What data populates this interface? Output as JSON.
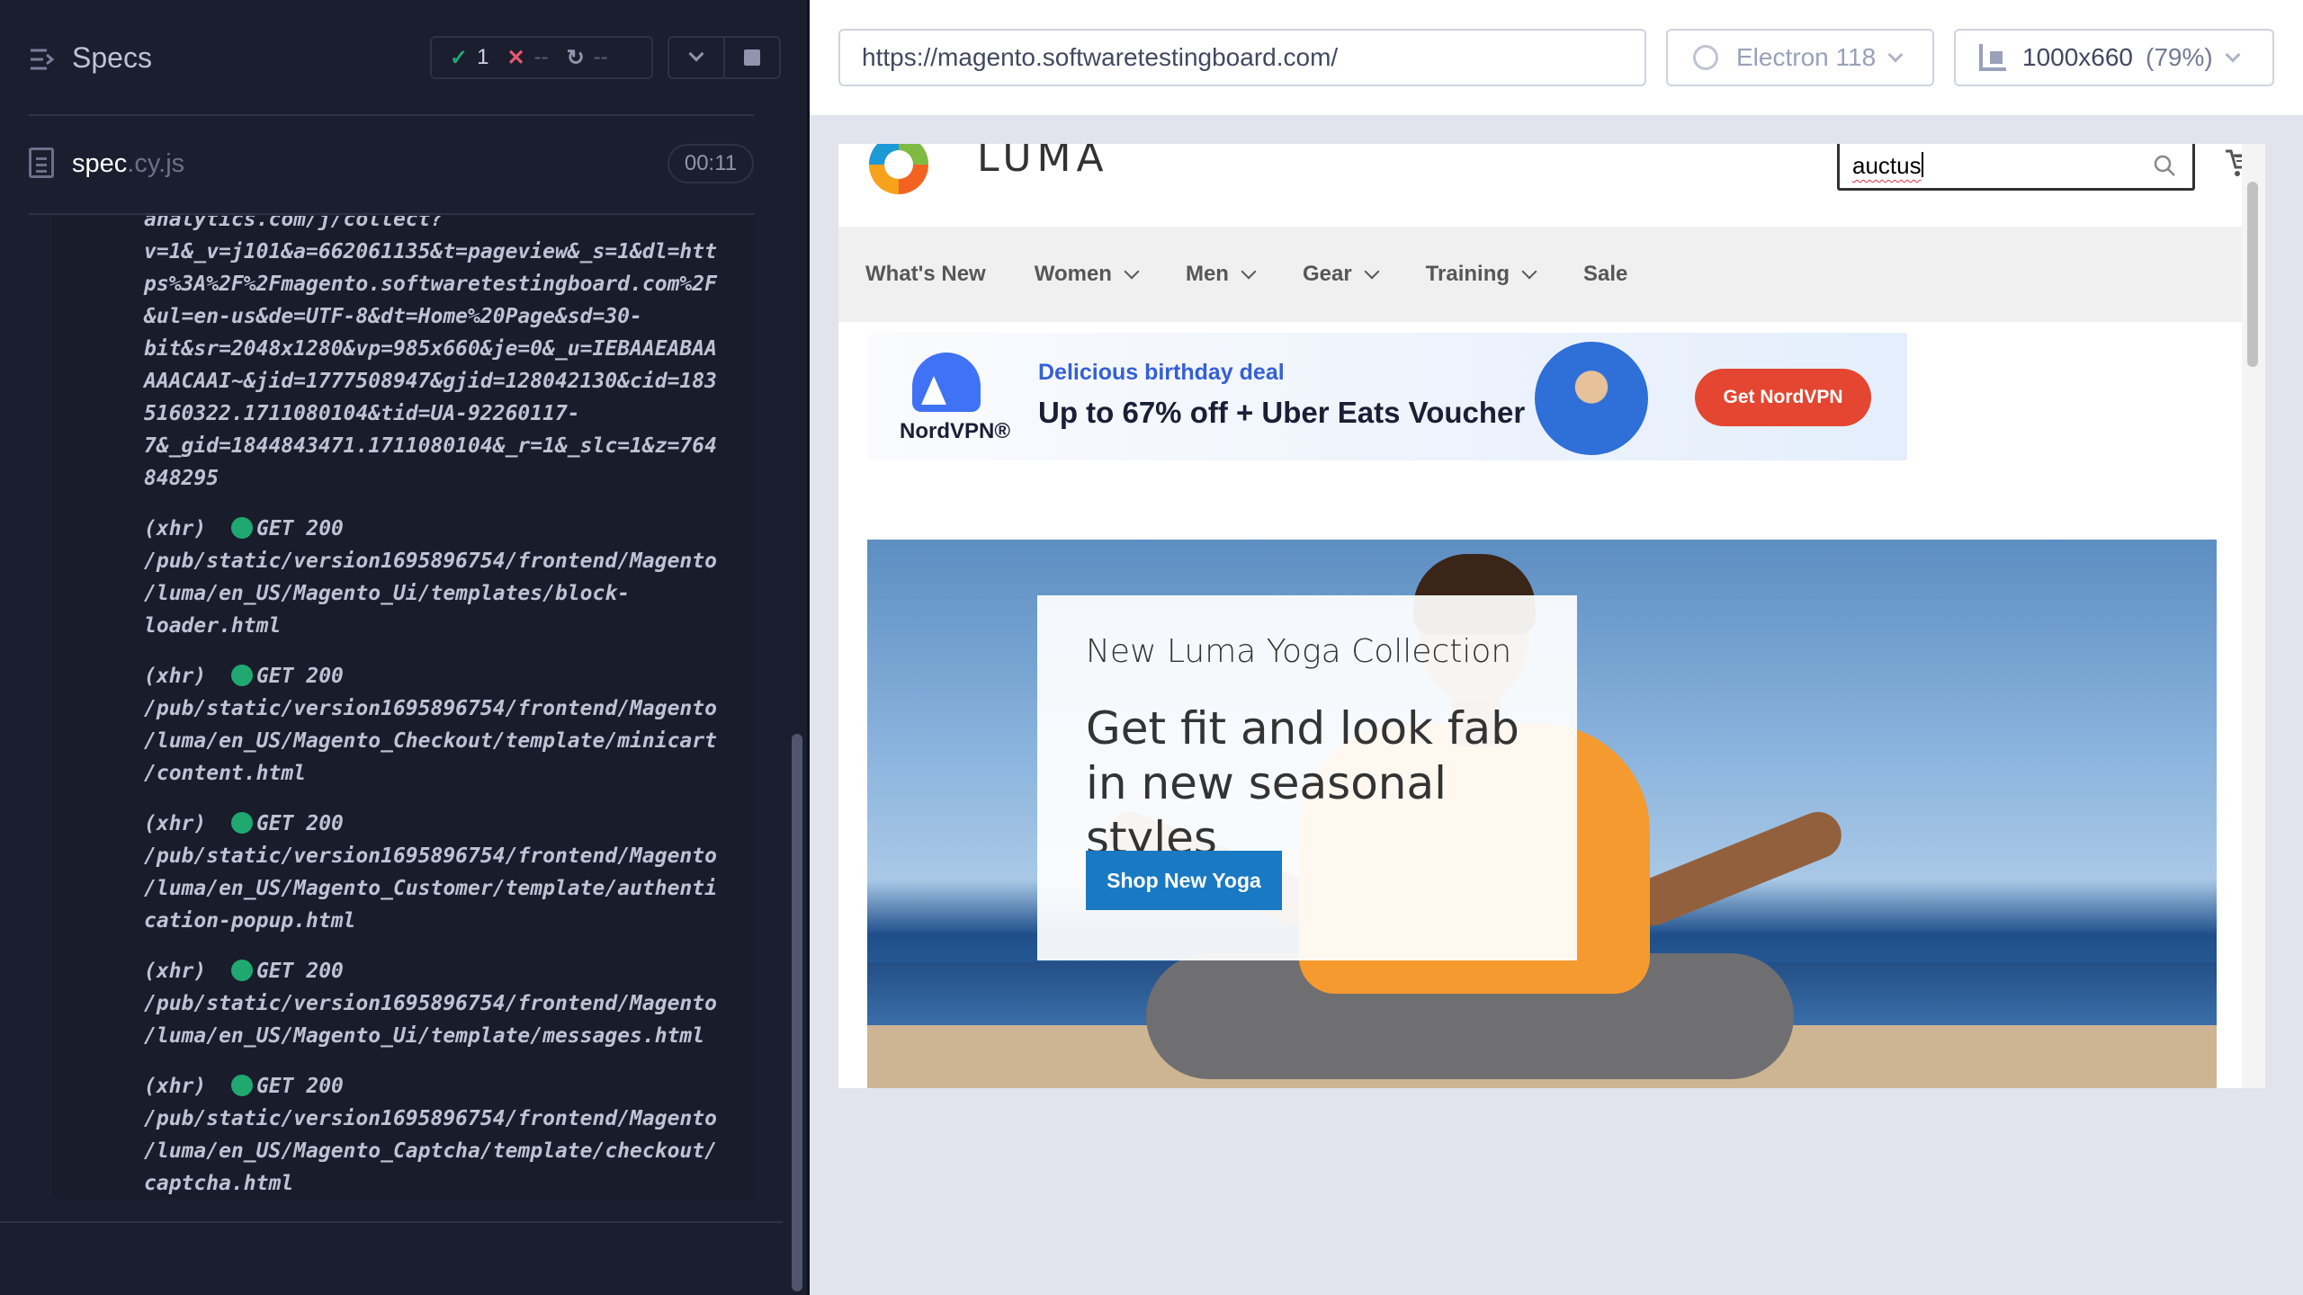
{
  "runner": {
    "specs_title": "Specs",
    "stats": {
      "passed": "1",
      "failed": "--",
      "pending": "--"
    },
    "spec": {
      "name": "spec",
      "ext": ".cy.js",
      "duration": "00:11"
    },
    "log": {
      "url_lines": [
        "analytics.com/j/collect?",
        "v=1&_v=j101&a=662061135&t=pageview&_s=1&dl=htt",
        "ps%3A%2F%2Fmagento.softwaretestingboard.com%2F",
        "&ul=en-us&de=UTF-8&dt=Home%20Page&sd=30-",
        "bit&sr=2048x1280&vp=985x660&je=0&_u=IEBAAEABAA",
        "AAACAAI~&jid=1777508947&gjid=128042130&cid=183",
        "5160322.1711080104&tid=UA-92260117-",
        "7&_gid=1844843471.1711080104&_r=1&_slc=1&z=764",
        "848295"
      ],
      "entries": [
        {
          "type": "(xhr)",
          "method": "GET 200",
          "lines": [
            "/pub/static/version1695896754/frontend/Magento",
            "/luma/en_US/Magento_Ui/templates/block-",
            "loader.html"
          ]
        },
        {
          "type": "(xhr)",
          "method": "GET 200",
          "lines": [
            "/pub/static/version1695896754/frontend/Magento",
            "/luma/en_US/Magento_Checkout/template/minicart",
            "/content.html"
          ]
        },
        {
          "type": "(xhr)",
          "method": "GET 200",
          "lines": [
            "/pub/static/version1695896754/frontend/Magento",
            "/luma/en_US/Magento_Customer/template/authenti",
            "cation-popup.html"
          ]
        },
        {
          "type": "(xhr)",
          "method": "GET 200",
          "lines": [
            "/pub/static/version1695896754/frontend/Magento",
            "/luma/en_US/Magento_Ui/template/messages.html"
          ]
        },
        {
          "type": "(xhr)",
          "method": "GET 200",
          "lines": [
            "/pub/static/version1695896754/frontend/Magento",
            "/luma/en_US/Magento_Captcha/template/checkout/",
            "captcha.html"
          ]
        }
      ]
    }
  },
  "toolbar": {
    "url": "https://magento.softwaretestingboard.com/",
    "browser": "Electron 118",
    "viewport": "1000x660",
    "scale": "(79%)"
  },
  "site": {
    "logo_text": "LUMA",
    "search_value": "auctus",
    "nav": [
      {
        "label": "What's New",
        "dropdown": false
      },
      {
        "label": "Women",
        "dropdown": true
      },
      {
        "label": "Men",
        "dropdown": true
      },
      {
        "label": "Gear",
        "dropdown": true
      },
      {
        "label": "Training",
        "dropdown": true
      },
      {
        "label": "Sale",
        "dropdown": false
      }
    ],
    "ad": {
      "brand": "NordVPN®",
      "kicker": "Delicious birthday deal",
      "headline": "Up to 67% off + Uber Eats Voucher",
      "cta": "Get NordVPN"
    },
    "hero": {
      "subtitle": "New Luma Yoga Collection",
      "title": "Get fit and look fab in new seasonal styles",
      "button": "Shop New Yoga"
    }
  },
  "colors": {
    "runner_bg": "#1b1e2e",
    "pass": "#1fa971",
    "fail": "#e45770",
    "luma_button": "#1979c3",
    "nord_blue": "#3f72f4",
    "nord_cta": "#e44631"
  }
}
